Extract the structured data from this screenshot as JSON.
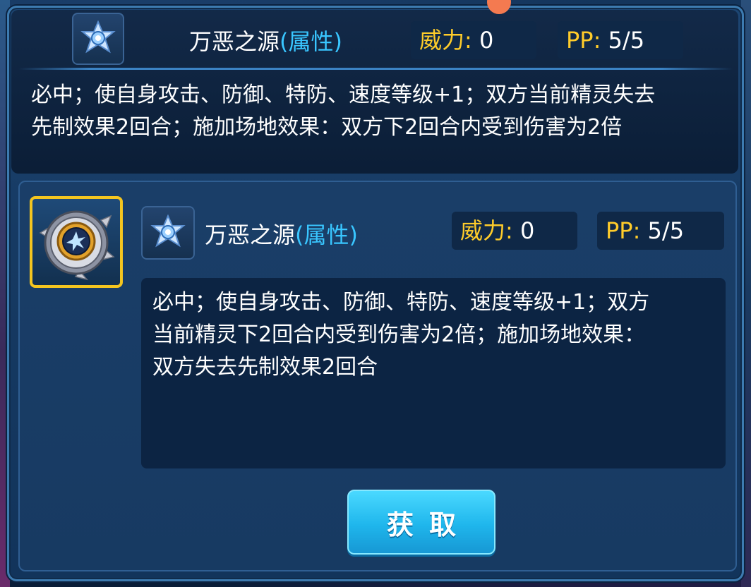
{
  "top_skill": {
    "name": "万恶之源",
    "type": "(属性)",
    "power_label": "威力:",
    "power_value": "0",
    "pp_label": "PP:",
    "pp_value": "5/5",
    "description_line1": "必中；使自身攻击、防御、特防、速度等级+1；双方当前精灵失去",
    "description_line2": "先制效果2回合；施加场地效果：双方下2回合内受到伤害为2倍",
    "icon": "star-gem-icon"
  },
  "new_skill": {
    "name": "万恶之源",
    "type": "(属性)",
    "power_label": "威力:",
    "power_value": "0",
    "pp_label": "PP:",
    "pp_value": "5/5",
    "description_line1": "必中；使自身攻击、防御、特防、速度等级+1；双方",
    "description_line2": "当前精灵下2回合内受到伤害为2倍；施加场地效果：",
    "description_line3": "双方失去先制效果2回合",
    "icon": "star-gem-icon",
    "item_icon": "spiked-orb-icon"
  },
  "get_button": {
    "label": "获取"
  },
  "colors": {
    "accent_yellow": "#ffcc2a",
    "type_blue": "#39c6ff",
    "button_cyan": "#1fb6ec",
    "frame_gold": "#f4c51f"
  }
}
